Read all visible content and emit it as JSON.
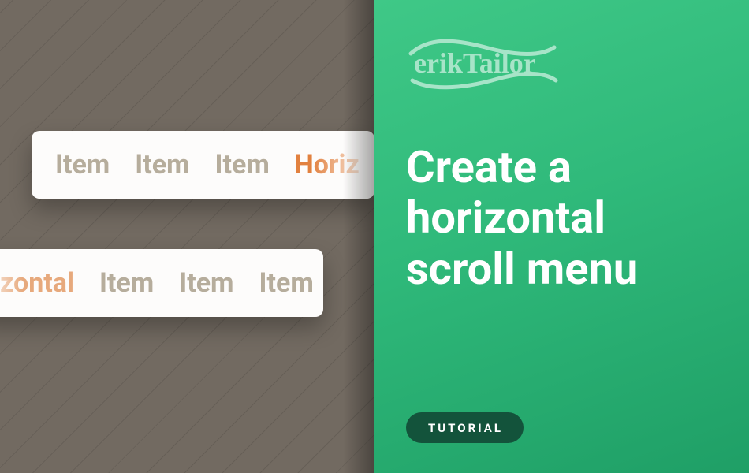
{
  "brand": {
    "name": "erikTailor"
  },
  "title": "Create a horizontal scroll menu",
  "badge": "TUTORIAL",
  "menus": {
    "top": {
      "items": [
        "Item",
        "Item",
        "Item"
      ],
      "accent_partial": "Horiz"
    },
    "bottom": {
      "accent_partial": "zontal",
      "items": [
        "Item",
        "Item",
        "Item"
      ]
    }
  },
  "colors": {
    "accent_green": "#2fb97a",
    "accent_orange": "#e2813f",
    "bg_left": "#726a61",
    "badge_bg": "#13533b"
  }
}
